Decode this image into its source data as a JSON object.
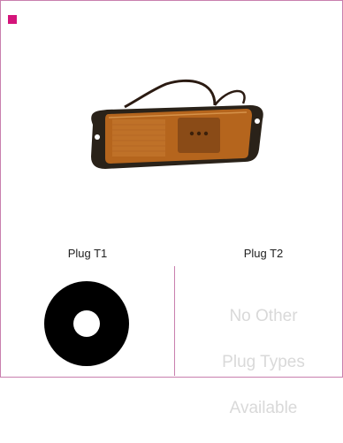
{
  "brand": {
    "accent_color": "#d4147a",
    "border_color": "#c97fae"
  },
  "product": {
    "image_icon": "amber-side-marker-lamp"
  },
  "plugs": {
    "t1_label": "Plug T1",
    "t2_label": "Plug T2",
    "t1_icon": "round-plug-icon",
    "t2_message_line1": "No Other",
    "t2_message_line2": "Plug Types",
    "t2_message_line3": "Available"
  }
}
